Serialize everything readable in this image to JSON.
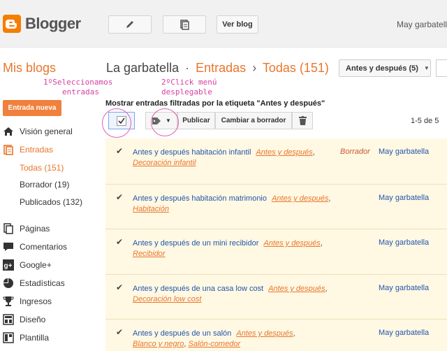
{
  "brand": {
    "name": "Blogger"
  },
  "topbar": {
    "view_blog": "Ver blog",
    "user": "May garbatella"
  },
  "header": {
    "my_blogs": "Mis blogs",
    "blog_name": "La garbatella",
    "separator": "·",
    "section": "Entradas",
    "arrow": "›",
    "filter": "Todas (151)",
    "label_dropdown": "Antes y después (5)"
  },
  "annotations": {
    "step1_line1": "1ºSeleccionamos",
    "step1_line2": "entradas",
    "step2_line1": "2ºClick menú",
    "step2_line2": "desplegable"
  },
  "sidebar": {
    "new_post": "Entrada nueva",
    "items": [
      {
        "label": "Visión general",
        "icon": "home-icon"
      },
      {
        "label": "Entradas",
        "icon": "posts-icon"
      },
      {
        "label": "Páginas",
        "icon": "pages-icon"
      },
      {
        "label": "Comentarios",
        "icon": "comment-icon"
      },
      {
        "label": "Google+",
        "icon": "googleplus-icon"
      },
      {
        "label": "Estadísticas",
        "icon": "stats-icon"
      },
      {
        "label": "Ingresos",
        "icon": "trophy-icon"
      },
      {
        "label": "Diseño",
        "icon": "layout-icon"
      },
      {
        "label": "Plantilla",
        "icon": "template-icon"
      }
    ],
    "sub_items": [
      "Todas (151)",
      "Borrador (19)",
      "Publicados (132)"
    ]
  },
  "main": {
    "filter_title": "Mostrar entradas filtradas por la etiqueta \"Antes y después\"",
    "toolbar": {
      "publish": "Publicar",
      "to_draft": "Cambiar a borrador"
    },
    "pager": "1-5 de 5",
    "posts": [
      {
        "title": "Antes y después habitación infantil",
        "labels": [
          "Antes y después",
          "Decoración infantil"
        ],
        "status": "Borrador",
        "author": "May garbatella"
      },
      {
        "title": "Antes y después habitación matrimonio",
        "labels": [
          "Antes y después",
          "Habitación"
        ],
        "status": "",
        "author": "May garbatella"
      },
      {
        "title": "Antes y después de un mini recibidor",
        "labels": [
          "Antes y después",
          "Recibidor"
        ],
        "status": "",
        "author": "May garbatella"
      },
      {
        "title": "Antes y después de una casa low cost",
        "labels": [
          "Antes y después",
          "Decoración low cost"
        ],
        "status": "",
        "author": "May garbatella"
      },
      {
        "title": "Antes y después de un salón",
        "labels": [
          "Antes y después",
          "Blanco y negro",
          "Salón-comedor"
        ],
        "status": "",
        "author": "May garbatella"
      }
    ]
  }
}
